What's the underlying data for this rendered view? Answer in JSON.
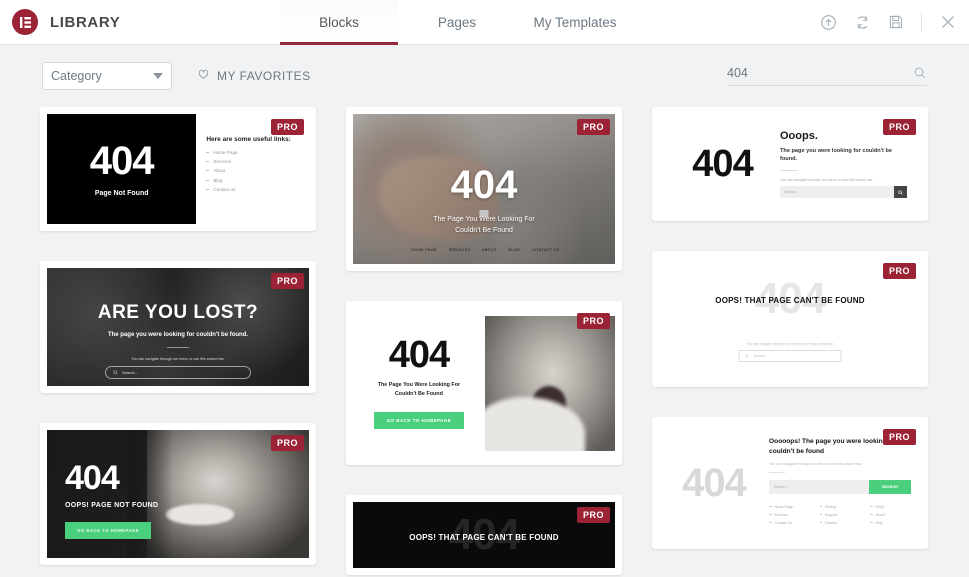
{
  "header": {
    "brand_title": "LIBRARY",
    "logo_icon": "elementor-logo-icon",
    "tabs": [
      {
        "label": "Blocks",
        "active": true
      },
      {
        "label": "Pages",
        "active": false
      },
      {
        "label": "My Templates",
        "active": false
      }
    ],
    "actions": [
      {
        "name": "upload-icon",
        "title": "Import Template"
      },
      {
        "name": "sync-icon",
        "title": "Sync Library"
      },
      {
        "name": "save-icon",
        "title": "Save"
      },
      {
        "name": "close-icon",
        "title": "Close"
      }
    ],
    "accent_color": "#93293a"
  },
  "filterbar": {
    "category_label": "Category",
    "favorites_label": "MY FAVORITES",
    "favorites_icon": "heart-icon",
    "search_value": "404",
    "search_placeholder": "Search",
    "search_icon": "search-icon"
  },
  "pro_badge": "PRO",
  "templates": [
    {
      "id": "black-split-404",
      "column": 1,
      "pro": true,
      "title_404": "404",
      "subtitle": "Page Not Found",
      "links_heading": "Here are some useful links:",
      "links": [
        "Home Page",
        "Services",
        "About",
        "Blog",
        "Contact us"
      ]
    },
    {
      "id": "keyboard-photo-404",
      "column": 2,
      "pro": true,
      "title_404": "404",
      "subtitle_line1": "The Page You Were Looking For",
      "subtitle_line2": "Couldn't Be Found",
      "nav": [
        "HOME PAGE",
        "SERVICES",
        "ABOUT",
        "BLOG",
        "CONTACT US"
      ]
    },
    {
      "id": "ooops-white-404",
      "column": 3,
      "pro": true,
      "title_404": "404",
      "heading": "Ooops.",
      "paragraph": "The page you were looking for couldn't be found.",
      "note": "You can navigate through our menu or use this search bar.",
      "search_placeholder": "Search...",
      "search_button_icon": "search-icon"
    },
    {
      "id": "are-you-lost",
      "column": 1,
      "pro": true,
      "heading": "ARE YOU LOST?",
      "paragraph": "The page you were looking for couldn't be found.",
      "note": "You can navigate through our menu or use this search bar.",
      "search_placeholder": "Search..."
    },
    {
      "id": "baby-split-404",
      "column": 2,
      "pro": true,
      "title_404": "404",
      "subtitle_line1": "The Page You Were Looking For",
      "subtitle_line2": "Couldn't Be Found",
      "button_label": "GO BACK TO HOMEPAGE",
      "button_color": "#4ad07d"
    },
    {
      "id": "oops-watermark-light",
      "column": 3,
      "pro": true,
      "watermark": "404",
      "heading": "OOPS! THAT PAGE CAN'T BE FOUND",
      "note": "You can navigate through our menu or use this search bar.",
      "search_placeholder": "Search..."
    },
    {
      "id": "man-face-404",
      "column": 1,
      "pro": true,
      "title_404": "404",
      "subtitle": "OOPS! PAGE NOT FOUND",
      "button_label": "GO BACK TO HOMEPAGE",
      "button_color": "#4ad07d"
    },
    {
      "id": "oops-watermark-dark",
      "column": 2,
      "pro": true,
      "watermark": "404",
      "heading": "OOPS! THAT PAGE CAN'T BE FOUND"
    },
    {
      "id": "gray-404-links",
      "column": 3,
      "pro": true,
      "title_404": "404",
      "heading": "Ooooops! The page you were looking for couldn't be found",
      "note": "You can navigate through our menu or use this search bar.",
      "search_placeholder": "Search...",
      "search_button_label": "SEARCH",
      "search_button_color": "#4ad07d",
      "link_col_1": [
        "Home Page",
        "Services",
        "Contact Us"
      ],
      "link_col_2": [
        "Pricing",
        "Support",
        "Forums"
      ],
      "link_col_3": [
        "FAQs",
        "About",
        "Blog"
      ]
    }
  ]
}
